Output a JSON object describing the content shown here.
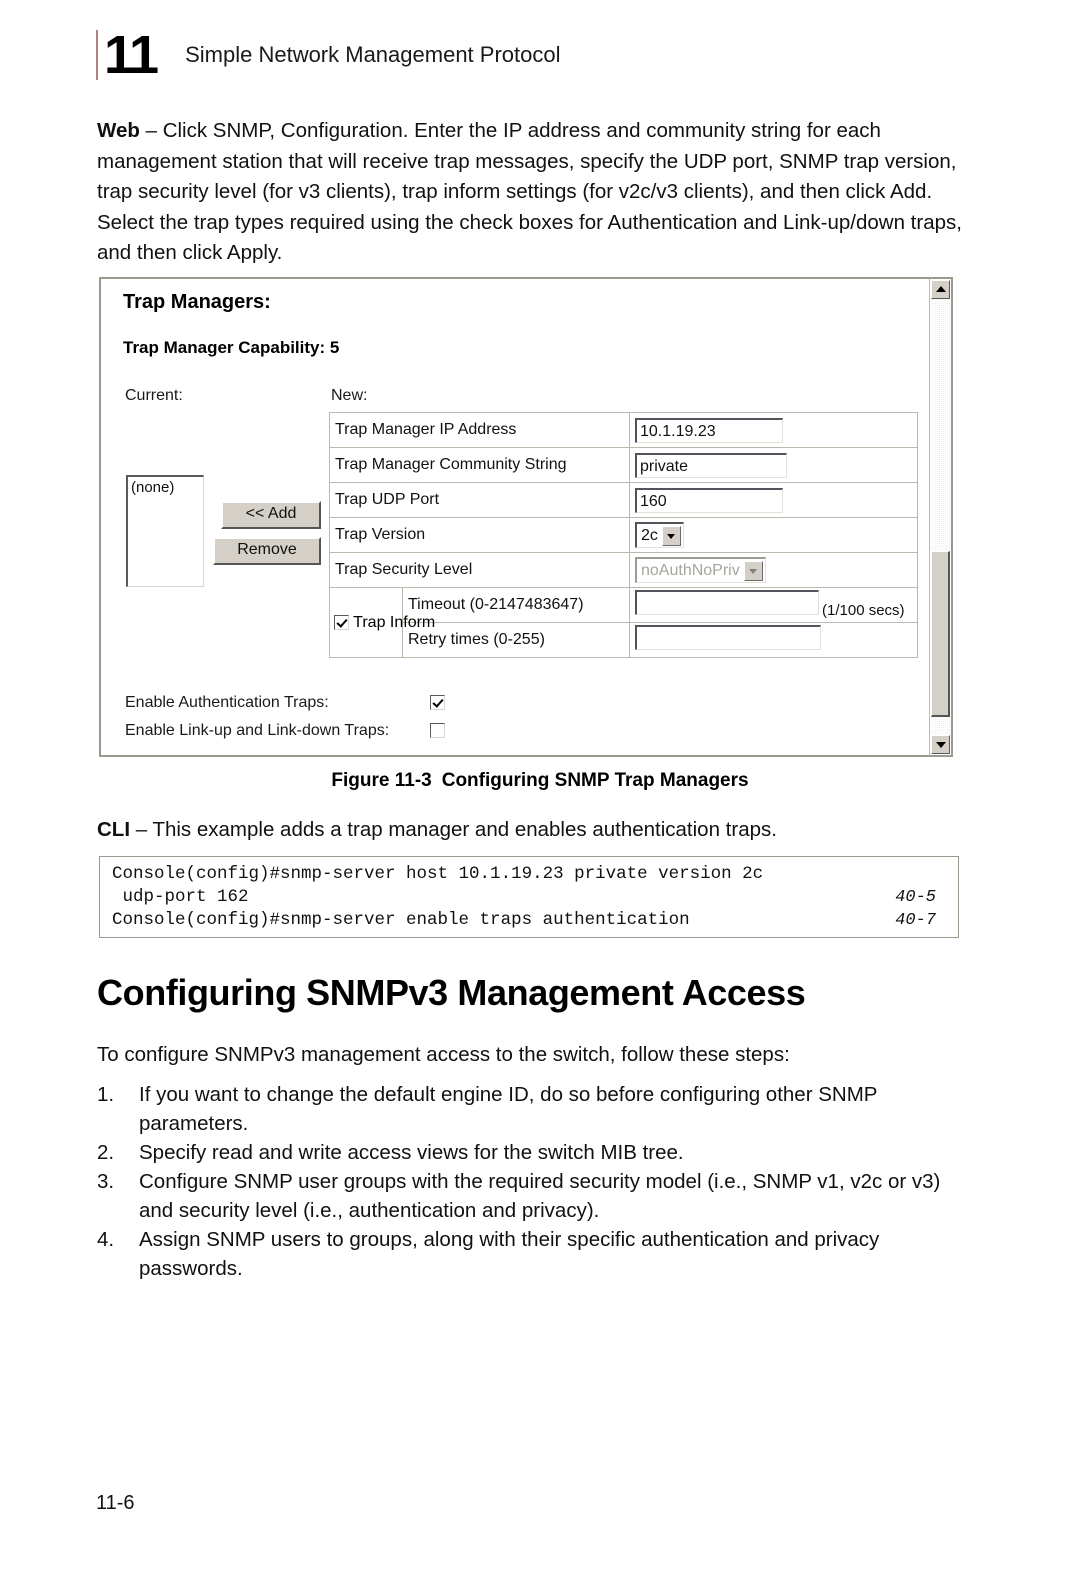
{
  "running_head": {
    "chapter_number": "11",
    "title": "Simple Network Management Protocol"
  },
  "lead_paragraph": {
    "bold_prefix": "Web",
    "text": " – Click SNMP, Configuration. Enter the IP address and community string for each management station that will receive trap messages, specify the UDP port, SNMP trap version, trap security level (for v3 clients), trap inform settings (for v2c/v3 clients), and then click Add. Select the trap types required using the check boxes for Authentication and Link-up/down traps, and then click Apply."
  },
  "screenshot": {
    "dialog_title": "Trap Managers:",
    "capability_label": "Trap Manager Capability: 5",
    "current_label": "Current:",
    "new_label": "New:",
    "current_list": {
      "items": [
        "(none)"
      ]
    },
    "buttons": {
      "add": "<< Add",
      "remove": "Remove"
    },
    "form_rows": [
      {
        "label": "Trap Manager IP Address",
        "value": "10.1.19.23",
        "type": "text"
      },
      {
        "label": "Trap Manager Community String",
        "value": "private",
        "type": "text"
      },
      {
        "label": "Trap UDP Port",
        "value": "160",
        "type": "text"
      },
      {
        "label": "Trap Version",
        "value": "2c",
        "type": "select"
      },
      {
        "label": "Trap Security Level",
        "value": "noAuthNoPriv",
        "type": "select-disabled"
      }
    ],
    "trap_inform": {
      "label": "Trap Inform",
      "checked": true,
      "timeout_label": "Timeout (0-2147483647)",
      "timeout_value": "",
      "timeout_unit": "(1/100 secs)",
      "retry_label": "Retry times (0-255)",
      "retry_value": ""
    },
    "trap_toggles": [
      {
        "label": "Enable Authentication Traps:",
        "checked": true
      },
      {
        "label": "Enable Link-up and Link-down Traps:",
        "checked": false
      }
    ],
    "scrollbar": {
      "up_icon": "triangle-up-icon",
      "down_icon": "triangle-down-icon"
    }
  },
  "figure_caption": {
    "number": "Figure 11-3",
    "title": "Configuring SNMP Trap Managers"
  },
  "cli": {
    "bold_prefix": "CLI",
    "lead_text": " – This example adds a trap manager and enables authentication traps.",
    "lines": [
      {
        "text": "Console(config)#snmp-server host 10.1.19.23 private version 2c",
        "ref": ""
      },
      {
        "text": " udp-port 162",
        "ref": "40-5"
      },
      {
        "text": "Console(config)#snmp-server enable traps authentication",
        "ref": "40-7"
      }
    ]
  },
  "section": {
    "heading": "Configuring SNMPv3 Management Access",
    "intro": "To configure SNMPv3 management access to the switch, follow these steps:",
    "steps": [
      {
        "num": "1.",
        "text": "If you want to change the default engine ID, do so before configuring other SNMP parameters."
      },
      {
        "num": "2.",
        "text": "Specify read and write access views for the switch MIB tree."
      },
      {
        "num": "3.",
        "text": "Configure SNMP user groups with the required security model (i.e., SNMP v1, v2c or v3) and security level (i.e., authentication and privacy)."
      },
      {
        "num": "4.",
        "text": "Assign SNMP users to groups, along with their specific authentication and privacy passwords."
      }
    ]
  },
  "footer": {
    "page_number": "11-6"
  }
}
